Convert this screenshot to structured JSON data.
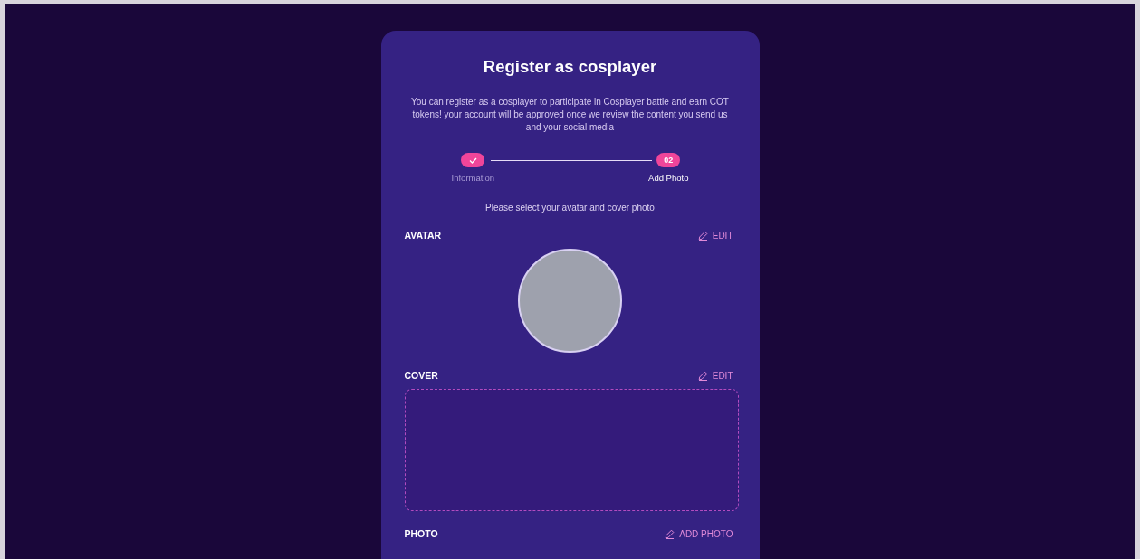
{
  "title": "Register as cosplayer",
  "description": "You can register as a cosplayer to participate in Cosplayer battle and earn COT tokens! your account will be approved once we review the content you send us and your social media",
  "steps": [
    {
      "label": "Information",
      "completed": true,
      "selected": false
    },
    {
      "label": "Add Photo",
      "number": "02",
      "completed": false,
      "selected": true
    }
  ],
  "instruction": "Please select your avatar and cover photo",
  "sections": [
    {
      "kind": "avatar",
      "label": "AVATAR",
      "action": "EDIT"
    },
    {
      "kind": "cover",
      "label": "COVER",
      "action": "EDIT"
    },
    {
      "kind": "photo",
      "label": "PHOTO",
      "action": "ADD PHOTO"
    }
  ]
}
